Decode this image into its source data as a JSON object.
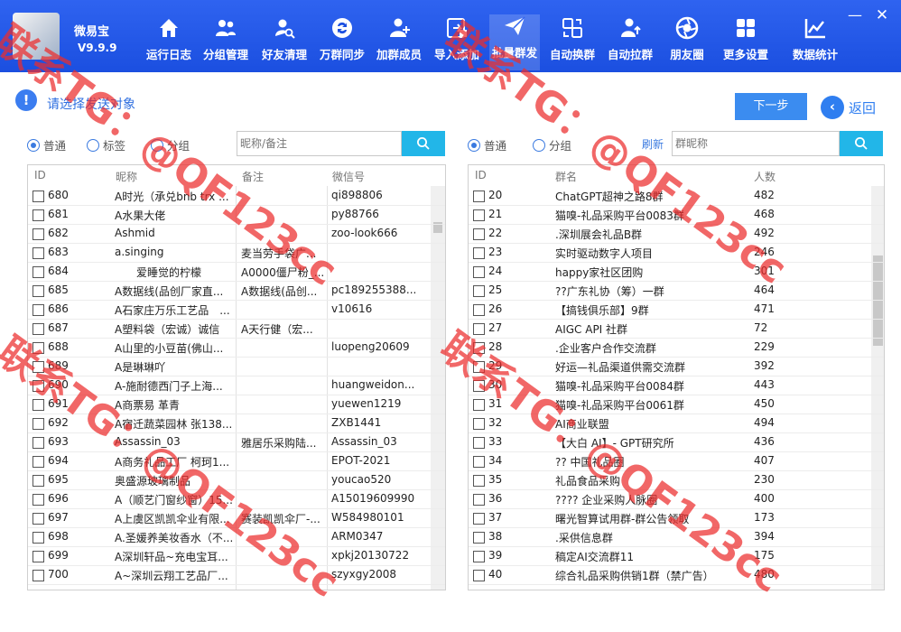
{
  "app": {
    "name": "微易宝",
    "version": "V9.9.9"
  },
  "window_controls": {
    "minimize": "—",
    "close": "✕"
  },
  "nav": [
    {
      "label": "运行日志",
      "icon": "home-icon"
    },
    {
      "label": "分组管理",
      "icon": "users-icon"
    },
    {
      "label": "好友清理",
      "icon": "user-search-icon"
    },
    {
      "label": "万群同步",
      "icon": "sync-icon"
    },
    {
      "label": "加群成员",
      "icon": "user-add-icon"
    },
    {
      "label": "导入添加",
      "icon": "import-icon"
    },
    {
      "label": "批量群发",
      "icon": "send-icon"
    },
    {
      "label": "自动换群",
      "icon": "swap-icon"
    },
    {
      "label": "自动拉群",
      "icon": "user-up-icon"
    },
    {
      "label": "朋友圈",
      "icon": "aperture-icon"
    },
    {
      "label": "更多设置",
      "icon": "grid-icon"
    },
    {
      "label": "数据统计",
      "icon": "chart-icon"
    }
  ],
  "tip": {
    "icon": "!",
    "text": "请选择发送对象"
  },
  "actions": {
    "next": "下一步",
    "back": "返回",
    "back_icon": "‹"
  },
  "left": {
    "radios": [
      "普通",
      "标签",
      "分组"
    ],
    "search_placeholder": "昵称/备注",
    "columns": [
      "ID",
      "昵称",
      "备注",
      "微信号"
    ],
    "rows": [
      [
        "680",
        "A时光（承兑bnb trx ...",
        "",
        "qi898806"
      ],
      [
        "681",
        "A水果大佬",
        "",
        "py88766"
      ],
      [
        "682",
        "Ashmid",
        "",
        "zoo-look666"
      ],
      [
        "683",
        "a.singing",
        "麦当劳手袋广...",
        ""
      ],
      [
        "684",
        "　　爱睡觉的柠檬",
        "A0000僵尸粉_...",
        ""
      ],
      [
        "685",
        "A数据线(品创厂家直...",
        "A数据线(品创...",
        "pc189255388..."
      ],
      [
        "686",
        "A石家庄万乐工艺品　...",
        "",
        "v10616"
      ],
      [
        "687",
        "A塑料袋（宏诚）诚信",
        "A天行健（宏...",
        ""
      ],
      [
        "688",
        "A山里的小豆苗(佛山...",
        "",
        "luopeng20609"
      ],
      [
        "689",
        "A是琳琳吖",
        "",
        ""
      ],
      [
        "690",
        "A-施耐德西门子上海...",
        "",
        "huangweidon..."
      ],
      [
        "691",
        "A商票易 革青",
        "",
        "yuewen1219"
      ],
      [
        "692",
        "A宿迁蔬菜园林 张138...",
        "",
        "ZXB1441"
      ],
      [
        "693",
        "Assassin_03",
        "雅居乐采购陆...",
        "Assassin_03"
      ],
      [
        "694",
        "A商务礼品工厂 柯珂1...",
        "",
        "EPOT-2021"
      ],
      [
        "695",
        "奥盛源玻璃制品",
        "",
        "youcao520"
      ],
      [
        "696",
        "A（顺艺门窗纱窗）15...",
        "",
        "A15019609990"
      ],
      [
        "697",
        "A上虞区凯凯伞业有限...",
        "赛装凯凯伞厂-...",
        "W584980101"
      ],
      [
        "698",
        "A.圣媛养美妆香水（不...",
        "",
        "ARM0347"
      ],
      [
        "699",
        "A深圳轩品~充电宝耳...",
        "",
        "xpkj20130722"
      ],
      [
        "700",
        "A~深圳云翔工艺品厂...",
        "",
        "szyxgy2008"
      ]
    ]
  },
  "right": {
    "radios": [
      "普通",
      "分组"
    ],
    "refresh": "刷新",
    "search_placeholder": "群昵称",
    "columns": [
      "ID",
      "群名",
      "人数"
    ],
    "rows": [
      [
        "20",
        "ChatGPT超神之路8群",
        "482"
      ],
      [
        "21",
        "猫嗅-礼品采购平台0083群",
        "468"
      ],
      [
        "22",
        ".深圳展会礼品B群",
        "492"
      ],
      [
        "23",
        "实时驱动数字人项目",
        "246"
      ],
      [
        "24",
        "happy家社区团购",
        "301"
      ],
      [
        "25",
        "??广东礼协（筹）一群",
        "464"
      ],
      [
        "26",
        "【搞钱俱乐部】9群",
        "471"
      ],
      [
        "27",
        "AIGC API 社群",
        "72"
      ],
      [
        "28",
        ".企业客户合作交流群",
        "229"
      ],
      [
        "29",
        "好运—礼品渠道供需交流群",
        "392"
      ],
      [
        "30",
        "猫嗅-礼品采购平台0084群",
        "443"
      ],
      [
        "31",
        "猫嗅-礼品采购平台0061群",
        "450"
      ],
      [
        "32",
        "AI商业联盟",
        "494"
      ],
      [
        "33",
        "【大白 AI】- GPT研究所",
        "436"
      ],
      [
        "34",
        "?? 中国礼品圈",
        "407"
      ],
      [
        "35",
        "礼品食品采购",
        "230"
      ],
      [
        "36",
        "???? 企业采购人脉圈",
        "400"
      ],
      [
        "37",
        "曙光智算试用群-群公告领取",
        "173"
      ],
      [
        "38",
        ".采供信息群",
        "394"
      ],
      [
        "39",
        "稿定AI交流群11",
        "175"
      ],
      [
        "40",
        "综合礼品采购供销1群（禁广告）",
        "480"
      ]
    ]
  },
  "watermark": "联系TG：@QF123cc",
  "colors": {
    "topbar": "#1b4fe0",
    "accent": "#3a7ae0",
    "search_button": "#22b6e8",
    "watermark": "#eb2d2d"
  }
}
